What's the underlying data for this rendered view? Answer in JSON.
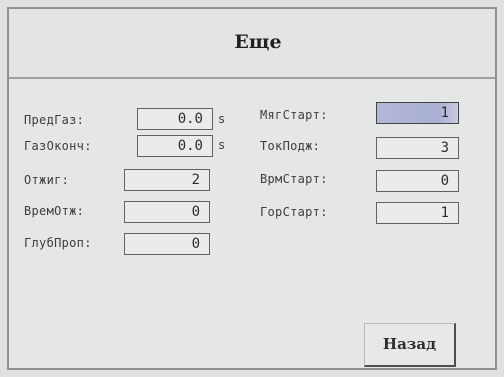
{
  "screen": {
    "title": "Еще"
  },
  "left_params": [
    {
      "label": "ПредГаз:",
      "value": "0.0",
      "unit": "s"
    },
    {
      "label": "ГазОконч:",
      "value": "0.0",
      "unit": "s"
    },
    {
      "label": "Отжиг:",
      "value": "2",
      "unit": ""
    },
    {
      "label": "ВремОтж:",
      "value": "0",
      "unit": ""
    },
    {
      "label": "ГлубПроп:",
      "value": "0",
      "unit": ""
    }
  ],
  "right_params": [
    {
      "label": "МягСтарт:",
      "value": "1",
      "selected": true
    },
    {
      "label": "ТокПодж:",
      "value": "3",
      "selected": false
    },
    {
      "label": "ВрмСтарт:",
      "value": "0",
      "selected": false
    },
    {
      "label": "ГорСтарт:",
      "value": "1",
      "selected": false
    }
  ],
  "buttons": {
    "back_label": "Назад"
  },
  "colors": {
    "background": "#e4e7e5",
    "selected_field": "#a9afd3",
    "border": "#5d6263"
  }
}
